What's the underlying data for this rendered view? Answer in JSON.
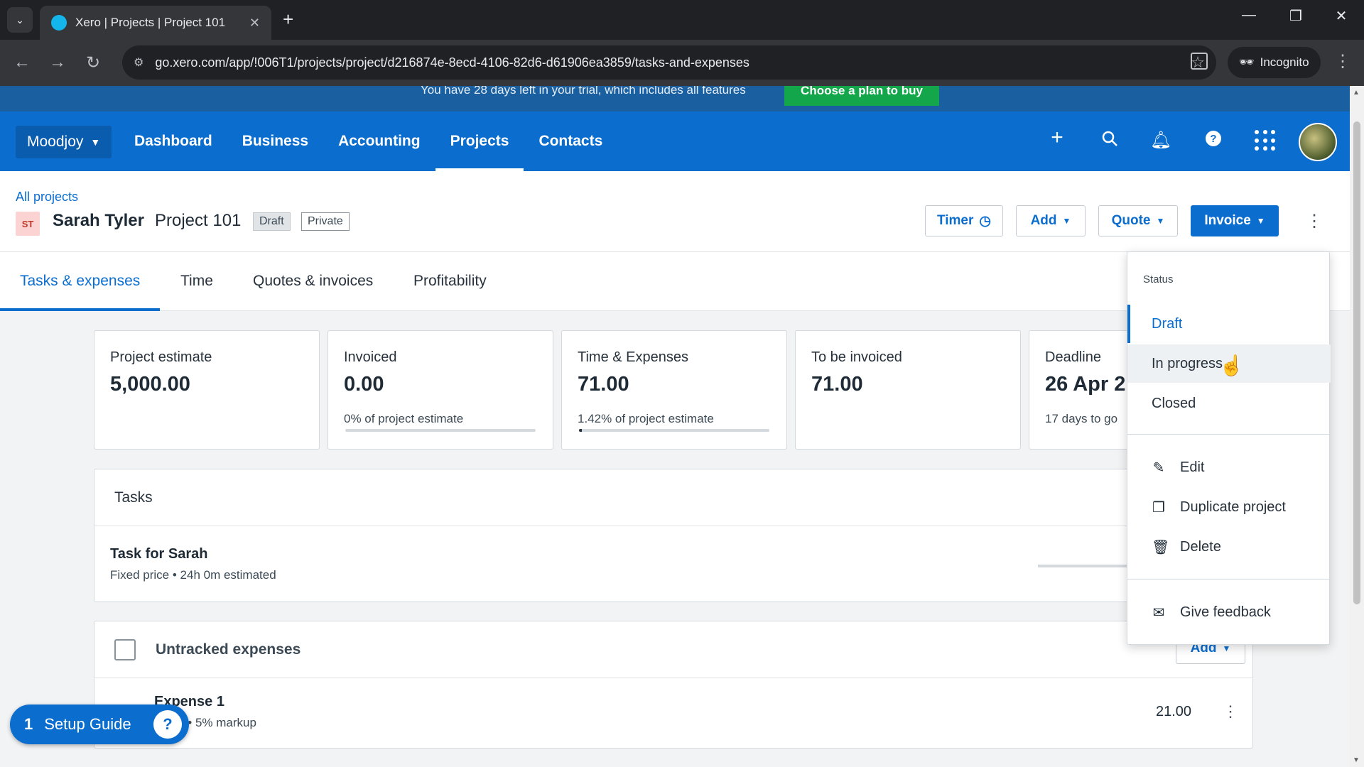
{
  "browser": {
    "tab_title": "Xero | Projects | Project 101",
    "url": "go.xero.com/app/!006T1/projects/project/d216874e-8ecd-4106-82d6-d61906ea3859/tasks-and-expenses",
    "incognito_label": "Incognito"
  },
  "trial": {
    "text": "You have 28 days left in your trial, which includes all features",
    "button": "Choose a plan to buy"
  },
  "header": {
    "org": "Moodjoy",
    "nav": [
      "Dashboard",
      "Business",
      "Accounting",
      "Projects",
      "Contacts"
    ],
    "active_nav": "Projects"
  },
  "project": {
    "breadcrumb": "All projects",
    "initials": "ST",
    "client": "Sarah Tyler",
    "name": "Project 101",
    "status_badge": "Draft",
    "visibility_badge": "Private",
    "buttons": {
      "timer": "Timer",
      "add": "Add",
      "quote": "Quote",
      "invoice": "Invoice"
    }
  },
  "tabs": [
    "Tasks & expenses",
    "Time",
    "Quotes & invoices",
    "Profitability"
  ],
  "cards": [
    {
      "label": "Project estimate",
      "value": "5,000.00",
      "sub": ""
    },
    {
      "label": "Invoiced",
      "value": "0.00",
      "sub": "0% of project estimate",
      "progress_pct": 0
    },
    {
      "label": "Time & Expenses",
      "value": "71.00",
      "sub": "1.42% of project estimate",
      "progress_pct": 1.42
    },
    {
      "label": "To be invoiced",
      "value": "71.00",
      "sub": ""
    },
    {
      "label": "Deadline",
      "value": "26 Apr 2",
      "sub": "17 days to go"
    }
  ],
  "tasks": {
    "heading": "Tasks",
    "items": [
      {
        "name": "Task for Sarah",
        "detail": "Fixed price • 24h 0m estimated"
      }
    ]
  },
  "expenses": {
    "heading": "Untracked expenses",
    "add_label": "Add",
    "items": [
      {
        "name": "Expense 1",
        "detail": "20.00 • 5% markup",
        "amount": "21.00"
      }
    ]
  },
  "setup_guide": {
    "count": "1",
    "label": "Setup Guide",
    "help": "?"
  },
  "dropdown": {
    "status_heading": "Status",
    "statuses": [
      "Draft",
      "In progress",
      "Closed"
    ],
    "selected": "Draft",
    "hovered": "In progress",
    "actions": [
      {
        "label": "Edit",
        "icon": "pencil-icon"
      },
      {
        "label": "Duplicate project",
        "icon": "copy-icon"
      },
      {
        "label": "Delete",
        "icon": "trash-icon"
      }
    ],
    "feedback": {
      "label": "Give feedback",
      "icon": "feedback-icon"
    }
  },
  "colors": {
    "brand": "#0b6ecf",
    "trial_cta": "#13a64a"
  }
}
